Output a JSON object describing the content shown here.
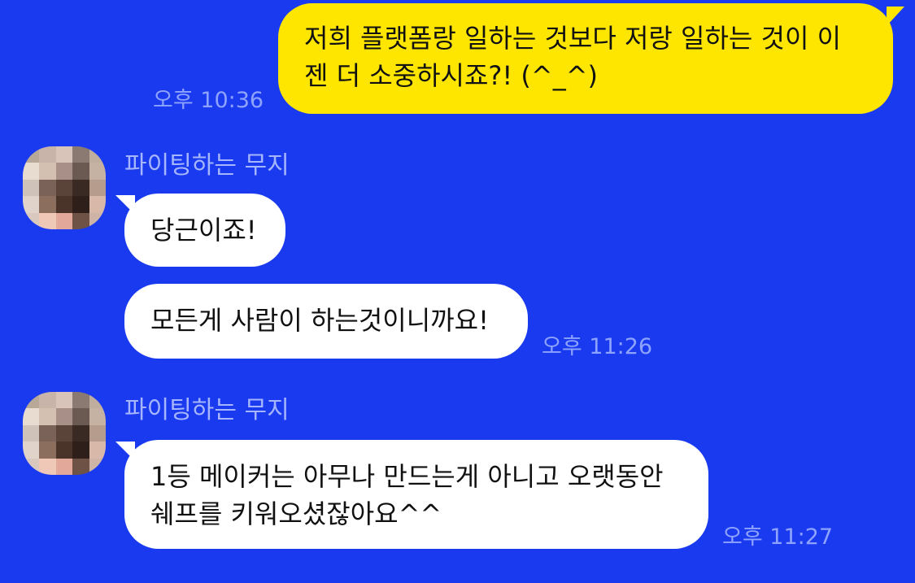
{
  "messages": [
    {
      "from": "me",
      "text": "저희 플랫폼랑 일하는 것보다 저랑 일하는 것이 이\n젠 더 소중하시죠?! (^_^)",
      "time": "오후 10:36"
    },
    {
      "from": "them",
      "sender": "파이팅하는 무지",
      "texts": [
        "당근이죠!",
        "모든게 사람이 하는것이니까요!"
      ],
      "time": "오후 11:26"
    },
    {
      "from": "them",
      "sender": "파이팅하는 무지",
      "texts": [
        "1등 메이커는 아무나 만드는게 아니고 오랫동안\n쉐프를 키워오셨잖아요^^"
      ],
      "time": "오후 11:27"
    }
  ],
  "colors": {
    "background": "#1a3af0",
    "my_bubble": "#ffe600",
    "their_bubble": "#ffffff",
    "timestamp": "#8ea3ff",
    "sender_name": "#a5b5ff"
  },
  "icons": {
    "avatar": "pixelated-avatar-icon"
  }
}
